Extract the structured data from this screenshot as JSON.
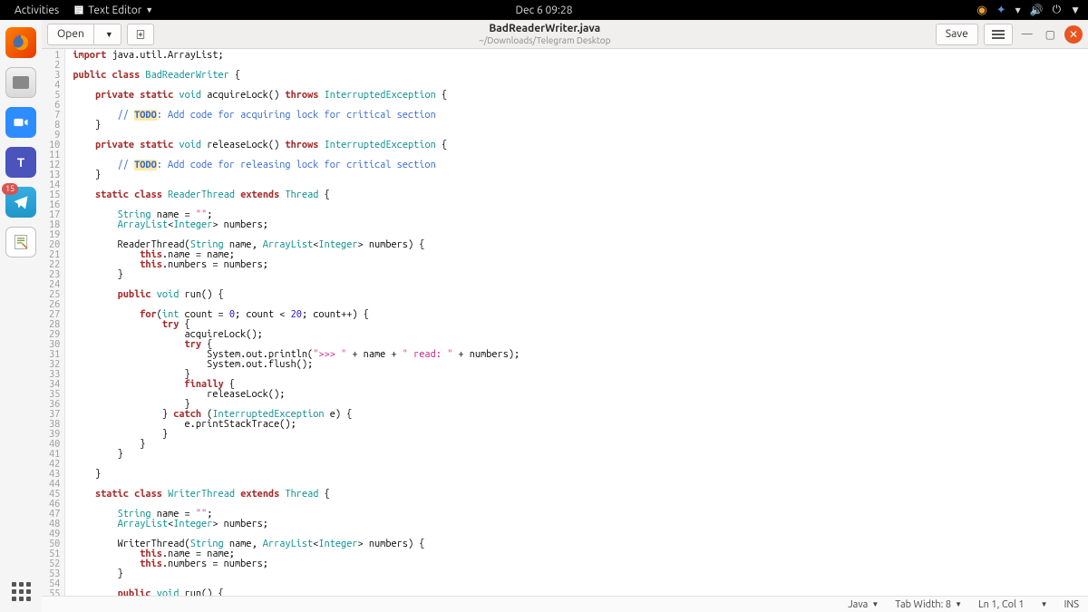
{
  "gnome": {
    "activities": "Activities",
    "app_name": "Text Editor",
    "clock": "Dec 6  09:28"
  },
  "dock": {
    "telegram_badge": "15"
  },
  "toolbar": {
    "open_label": "Open",
    "save_label": "Save",
    "filename": "BadReaderWriter.java",
    "filepath": "~/Downloads/Telegram Desktop"
  },
  "status": {
    "lang": "Java",
    "tabwidth": "Tab Width: 8",
    "position": "Ln 1, Col 1",
    "ins": "INS"
  },
  "code": {
    "line_start": 1,
    "line_end": 55
  }
}
